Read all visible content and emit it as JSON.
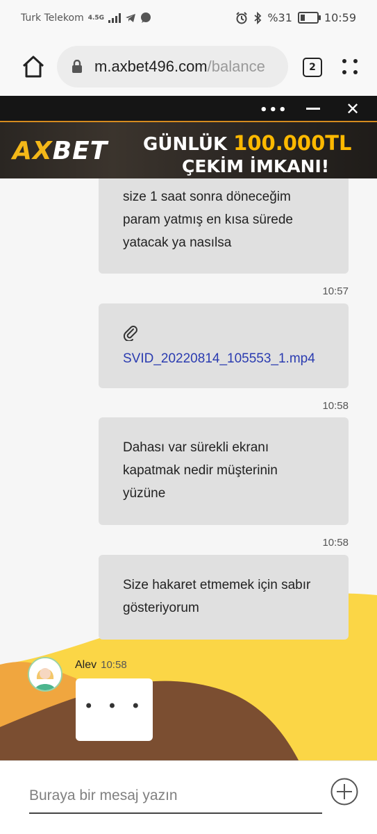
{
  "status": {
    "carrier": "Turk Telekom",
    "network": "4.5G",
    "battery": "%31",
    "time": "10:59"
  },
  "browser": {
    "url_host": "m.axbet496.com",
    "url_path": "/balance",
    "tab_count": "2"
  },
  "banner": {
    "logo_ax": "AX",
    "logo_bet": "BET",
    "line1_prefix": "GÜNLÜK ",
    "line1_amount": "100.000TL",
    "line2": "ÇEKİM İMKANI!",
    "menu_dots": "•••",
    "close": "✕"
  },
  "chat": {
    "messages": [
      {
        "lines": [
          "size 1 saat sonra döneceğim",
          "param yatmış en kısa sürede",
          "yatacak ya nasılsa"
        ],
        "time": "10:57"
      },
      {
        "attachment": "SVID_20220814_105553_1.mp4",
        "time": "10:58"
      },
      {
        "lines": [
          "Dahası var sürekli ekranı",
          "kapatmak nedir müşterinin",
          "yüzüne"
        ],
        "time": "10:58"
      },
      {
        "lines": [
          "Size hakaret etmemek için sabır",
          "gösteriyorum"
        ]
      }
    ],
    "agent": {
      "name": "Alev",
      "time": "10:58",
      "typing": "• • •"
    }
  },
  "composer": {
    "placeholder": "Buraya bir mesaj yazın"
  },
  "colors": {
    "accent": "#f4b818",
    "link": "#2a3bb0",
    "bubble": "#e0e0e0"
  }
}
